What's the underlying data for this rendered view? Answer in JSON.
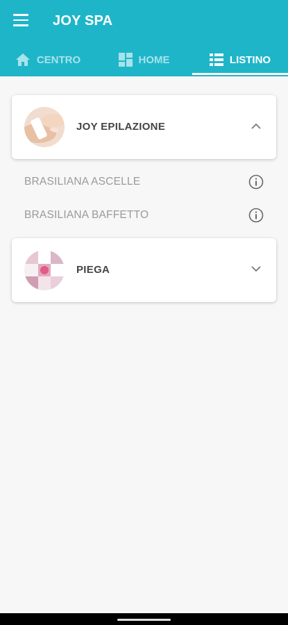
{
  "app": {
    "title": "JOY SPA",
    "colors": {
      "primary": "#1fb5c9",
      "tab_inactive": "#a7e3eb",
      "tab_active": "#ffffff",
      "background": "#f7f7f7"
    }
  },
  "tabs": [
    {
      "label": "CENTRO",
      "icon": "home-icon",
      "active": false
    },
    {
      "label": "HOME",
      "icon": "dashboard-icon",
      "active": false
    },
    {
      "label": "LISTINO",
      "icon": "list-icon",
      "active": true
    }
  ],
  "categories": [
    {
      "title": "JOY EPILAZIONE",
      "expanded": true,
      "thumbnail": "waxing-photo",
      "items": [
        {
          "label": "BRASILIANA ASCELLE",
          "icon": "info-icon"
        },
        {
          "label": "BRASILIANA BAFFETTO",
          "icon": "info-icon"
        }
      ]
    },
    {
      "title": "PIEGA",
      "expanded": false,
      "thumbnail": "hair-collage-photo",
      "items": []
    }
  ]
}
